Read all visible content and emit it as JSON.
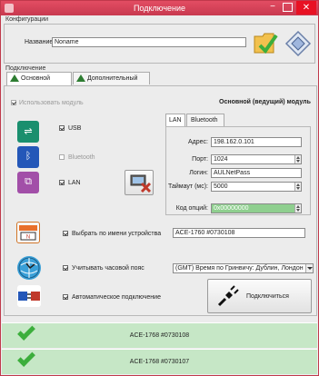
{
  "window": {
    "title": "Подключение",
    "minimize": "−",
    "close": "✕"
  },
  "config": {
    "group_title": "Конфигурации",
    "name_label": "Название",
    "name_value": "Noname"
  },
  "connection": {
    "group_title": "Подключение",
    "tabs": [
      "Основной",
      "Дополнительный"
    ],
    "use_module_label": "Использовать модуль",
    "module_status": "Основной (ведущий) модуль",
    "usb_label": "USB",
    "bluetooth_label": "Bluetooth",
    "lan_label": "LAN",
    "inner_tabs": [
      "LAN",
      "Bluetooth"
    ],
    "address_label": "Адрес:",
    "address_value": "198.162.0.101",
    "port_label": "Порт:",
    "port_value": "1024",
    "login_label": "Логин:",
    "login_value": "AULNetPass",
    "timeout_label": "Таймаут (мс):",
    "timeout_value": "5000",
    "options_label": "Код опций:",
    "options_value": "0x00000000",
    "select_by_name_label": "Выбрать по имени устройства",
    "device_name_value": "ACE-1760 #0730108",
    "timezone_label": "Учитывать часовой пояс",
    "timezone_value": "(GMT) Время по Гринвичу: Дублин, Лондон",
    "auto_connect_label": "Автоматическое подключение",
    "connect_button": "Подключиться"
  },
  "devices": [
    {
      "name": "ACE-1768 #0730108"
    },
    {
      "name": "ACE-1768 #0730107"
    }
  ]
}
